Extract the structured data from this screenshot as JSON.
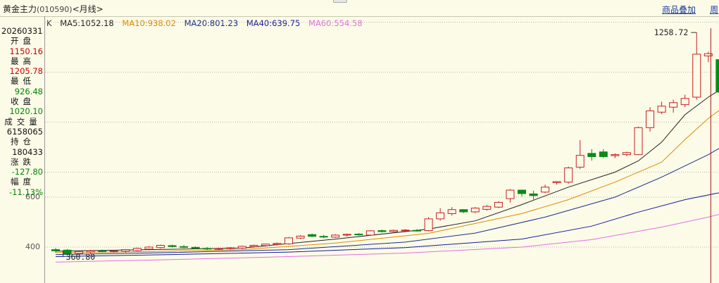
{
  "header": {
    "title": "黄金主力",
    "code": "(010590)",
    "period_nav": "<月线>",
    "overlay_link": "商品叠加",
    "period_link": "周"
  },
  "ma_legend": [
    {
      "label": "K",
      "color": "#333333"
    },
    {
      "label": "MA5:1052.18",
      "color": "#222222"
    },
    {
      "label": "MA10:938.02",
      "color": "#e08a00"
    },
    {
      "label": "MA20:801.23",
      "color": "#1a2f8a"
    },
    {
      "label": "MA40:639.75",
      "color": "#1a1aa0"
    },
    {
      "label": "MA60:554.58",
      "color": "#e070e0"
    }
  ],
  "side_panel": {
    "date": "20260331",
    "rows": [
      {
        "label": "开盘",
        "value": "1150.16",
        "color": "#cc0000"
      },
      {
        "label": "最高",
        "value": "1205.78",
        "color": "#cc0000"
      },
      {
        "label": "最低",
        "value": "926.48",
        "color": "#008800"
      },
      {
        "label": "收盘",
        "value": "1020.10",
        "color": "#008800"
      },
      {
        "label": "成交量",
        "value": "6158065",
        "color": "#111111"
      },
      {
        "label": "持仓",
        "value": "180433",
        "color": "#111111"
      },
      {
        "label": "涨跌",
        "value": "-127.80",
        "color": "#008800"
      },
      {
        "label": "幅度",
        "value": "-11.13%",
        "color": "#008800"
      }
    ]
  },
  "colors": {
    "up": "#c82020",
    "down": "#0a8a1a",
    "grid": "#b8b8a8",
    "crosshair": "#a01818"
  },
  "chart_data": {
    "type": "candlestick",
    "y_ticks": [
      400,
      600
    ],
    "y_tick_labels": [
      "400",
      "600"
    ],
    "annotations": {
      "high_label": "1258.72",
      "low_label": "360.80"
    },
    "candles": [
      {
        "o": 390,
        "h": 396,
        "l": 378,
        "c": 385
      },
      {
        "o": 388,
        "h": 392,
        "l": 366,
        "c": 372
      },
      {
        "o": 375,
        "h": 386,
        "l": 370,
        "c": 382
      },
      {
        "o": 380,
        "h": 389,
        "l": 373,
        "c": 385
      },
      {
        "o": 384,
        "h": 390,
        "l": 379,
        "c": 383
      },
      {
        "o": 383,
        "h": 388,
        "l": 378,
        "c": 384
      },
      {
        "o": 384,
        "h": 392,
        "l": 378,
        "c": 390
      },
      {
        "o": 386,
        "h": 398,
        "l": 382,
        "c": 395
      },
      {
        "o": 392,
        "h": 404,
        "l": 387,
        "c": 400
      },
      {
        "o": 398,
        "h": 410,
        "l": 394,
        "c": 407
      },
      {
        "o": 406,
        "h": 410,
        "l": 398,
        "c": 402
      },
      {
        "o": 402,
        "h": 408,
        "l": 396,
        "c": 399
      },
      {
        "o": 399,
        "h": 403,
        "l": 392,
        "c": 395
      },
      {
        "o": 395,
        "h": 400,
        "l": 388,
        "c": 393
      },
      {
        "o": 392,
        "h": 398,
        "l": 388,
        "c": 394
      },
      {
        "o": 394,
        "h": 400,
        "l": 390,
        "c": 397
      },
      {
        "o": 396,
        "h": 406,
        "l": 392,
        "c": 403
      },
      {
        "o": 402,
        "h": 410,
        "l": 398,
        "c": 407
      },
      {
        "o": 406,
        "h": 414,
        "l": 402,
        "c": 412
      },
      {
        "o": 411,
        "h": 418,
        "l": 406,
        "c": 415
      },
      {
        "o": 413,
        "h": 440,
        "l": 410,
        "c": 437
      },
      {
        "o": 436,
        "h": 448,
        "l": 432,
        "c": 444
      },
      {
        "o": 450,
        "h": 454,
        "l": 440,
        "c": 443
      },
      {
        "o": 443,
        "h": 449,
        "l": 436,
        "c": 440
      },
      {
        "o": 440,
        "h": 452,
        "l": 437,
        "c": 448
      },
      {
        "o": 448,
        "h": 454,
        "l": 442,
        "c": 451
      },
      {
        "o": 452,
        "h": 456,
        "l": 446,
        "c": 449
      },
      {
        "o": 448,
        "h": 468,
        "l": 445,
        "c": 465
      },
      {
        "o": 466,
        "h": 470,
        "l": 458,
        "c": 462
      },
      {
        "o": 462,
        "h": 470,
        "l": 459,
        "c": 467
      },
      {
        "o": 466,
        "h": 472,
        "l": 460,
        "c": 468
      },
      {
        "o": 467,
        "h": 472,
        "l": 462,
        "c": 466
      },
      {
        "o": 466,
        "h": 520,
        "l": 463,
        "c": 513
      },
      {
        "o": 513,
        "h": 556,
        "l": 506,
        "c": 537
      },
      {
        "o": 534,
        "h": 560,
        "l": 526,
        "c": 550
      },
      {
        "o": 550,
        "h": 552,
        "l": 536,
        "c": 541
      },
      {
        "o": 541,
        "h": 560,
        "l": 536,
        "c": 556
      },
      {
        "o": 551,
        "h": 568,
        "l": 546,
        "c": 563
      },
      {
        "o": 560,
        "h": 584,
        "l": 556,
        "c": 579
      },
      {
        "o": 594,
        "h": 632,
        "l": 578,
        "c": 628
      },
      {
        "o": 628,
        "h": 630,
        "l": 602,
        "c": 614
      },
      {
        "o": 613,
        "h": 626,
        "l": 590,
        "c": 606
      },
      {
        "o": 620,
        "h": 650,
        "l": 616,
        "c": 640
      },
      {
        "o": 658,
        "h": 664,
        "l": 650,
        "c": 662
      },
      {
        "o": 660,
        "h": 722,
        "l": 654,
        "c": 717
      },
      {
        "o": 720,
        "h": 828,
        "l": 712,
        "c": 767
      },
      {
        "o": 775,
        "h": 792,
        "l": 746,
        "c": 762
      },
      {
        "o": 781,
        "h": 792,
        "l": 756,
        "c": 762
      },
      {
        "o": 766,
        "h": 775,
        "l": 756,
        "c": 770
      },
      {
        "o": 770,
        "h": 782,
        "l": 764,
        "c": 778
      },
      {
        "o": 770,
        "h": 882,
        "l": 768,
        "c": 878
      },
      {
        "o": 878,
        "h": 960,
        "l": 862,
        "c": 945
      },
      {
        "o": 940,
        "h": 982,
        "l": 932,
        "c": 964
      },
      {
        "o": 960,
        "h": 990,
        "l": 938,
        "c": 978
      },
      {
        "o": 970,
        "h": 1010,
        "l": 960,
        "c": 995
      },
      {
        "o": 1000,
        "h": 1258.72,
        "l": 990,
        "c": 1172
      },
      {
        "o": 1165,
        "h": 1182,
        "l": 1140,
        "c": 1174
      },
      {
        "o": 1150.16,
        "h": 1205.78,
        "l": 926.48,
        "c": 1020.1
      }
    ],
    "ma": [
      {
        "name": "MA5",
        "color": "#222222",
        "values": [
          [
            0,
            384
          ],
          [
            8,
            390
          ],
          [
            16,
            396
          ],
          [
            24,
            432
          ],
          [
            32,
            472
          ],
          [
            36,
            505
          ],
          [
            40,
            570
          ],
          [
            44,
            640
          ],
          [
            48,
            700
          ],
          [
            50,
            745
          ],
          [
            52,
            820
          ],
          [
            54,
            930
          ],
          [
            56,
            1000
          ],
          [
            57,
            1030
          ]
        ]
      },
      {
        "name": "MA10",
        "color": "#e08a00",
        "values": [
          [
            0,
            378
          ],
          [
            8,
            382
          ],
          [
            16,
            390
          ],
          [
            24,
            416
          ],
          [
            32,
            455
          ],
          [
            40,
            534
          ],
          [
            44,
            590
          ],
          [
            48,
            660
          ],
          [
            52,
            740
          ],
          [
            54,
            830
          ],
          [
            56,
            915
          ],
          [
            57,
            950
          ]
        ]
      },
      {
        "name": "MA20",
        "color": "#1a2f8a",
        "values": [
          [
            0,
            370
          ],
          [
            10,
            378
          ],
          [
            20,
            390
          ],
          [
            30,
            420
          ],
          [
            36,
            456
          ],
          [
            42,
            520
          ],
          [
            48,
            600
          ],
          [
            52,
            680
          ],
          [
            56,
            770
          ],
          [
            57,
            797
          ]
        ]
      },
      {
        "name": "MA40",
        "color": "#1a1aa0",
        "values": [
          [
            0,
            362
          ],
          [
            10,
            370
          ],
          [
            20,
            380
          ],
          [
            30,
            398
          ],
          [
            40,
            432
          ],
          [
            46,
            484
          ],
          [
            50,
            540
          ],
          [
            54,
            590
          ],
          [
            57,
            618
          ]
        ]
      },
      {
        "name": "MA60",
        "color": "#e070e0",
        "values": [
          [
            0,
            340
          ],
          [
            10,
            350
          ],
          [
            20,
            362
          ],
          [
            30,
            376
          ],
          [
            40,
            400
          ],
          [
            46,
            430
          ],
          [
            52,
            480
          ],
          [
            56,
            520
          ],
          [
            57,
            532
          ]
        ]
      }
    ]
  }
}
